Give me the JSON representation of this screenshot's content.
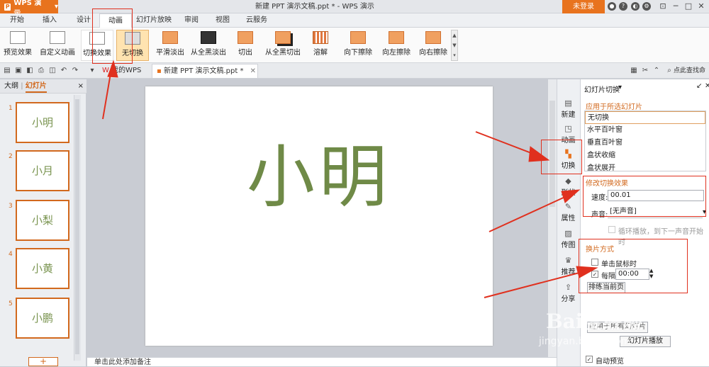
{
  "app": {
    "name": "WPS 演示",
    "logo_letter": "P",
    "dropdown": "▾"
  },
  "title": "新建 PPT 演示文稿.ppt * - WPS 演示",
  "login": "未登录",
  "menu_tabs": [
    "开始",
    "插入",
    "设计",
    "动画",
    "幻灯片放映",
    "审阅",
    "视图",
    "云服务"
  ],
  "ribbon": {
    "buttons": [
      "预览效果",
      "自定义动画",
      "切换效果",
      "无切换",
      "平滑淡出",
      "从全黑淡出",
      "切出",
      "从全黑切出",
      "溶解",
      "向下擦除",
      "向左擦除",
      "向右擦除"
    ]
  },
  "doc_tabs": {
    "home": "我的WPS",
    "doc": "新建 PPT 演示文稿.ppt *"
  },
  "search": "点此查找命",
  "left_panel": {
    "outline": "大纲",
    "slides": "幻灯片",
    "close": "×",
    "add": "+"
  },
  "slides": [
    {
      "num": "1",
      "text": "小明"
    },
    {
      "num": "2",
      "text": "小月"
    },
    {
      "num": "3",
      "text": "小梨"
    },
    {
      "num": "4",
      "text": "小黄"
    },
    {
      "num": "5",
      "text": "小鹏"
    }
  ],
  "slide_main_text": "小明",
  "notes_placeholder": "单击此处添加备注",
  "side_icons": [
    "新建",
    "动画",
    "切换",
    "形状",
    "属性",
    "传图",
    "推荐",
    "分享"
  ],
  "task_pane": {
    "title": "幻灯片切换",
    "apply_heading": "应用于所选幻灯片",
    "transitions": [
      "无切换",
      "水平百叶窗",
      "垂直百叶窗",
      "盒状收缩",
      "盒状展开"
    ],
    "modify_heading": "修改切换效果",
    "speed_label": "速度:",
    "speed_value": "00.01",
    "sound_label": "声音:",
    "sound_value": "[无声音]",
    "loop_label": "循环播放，到下一声音开始时",
    "advance_heading": "换片方式",
    "on_click": "单击鼠标时",
    "every_label": "每隔",
    "every_value": "00:00",
    "rehearse": "排练当前页",
    "apply_all": "应用于所有幻灯片",
    "play": "幻灯片播放",
    "auto_preview": "自动预览"
  },
  "watermark": "Bai度经验",
  "watermark_url": "jingyan.baidu.com",
  "colors": {
    "accent": "#e8731e",
    "annotation": "#e0301e",
    "slide_text": "#6f8a47"
  }
}
